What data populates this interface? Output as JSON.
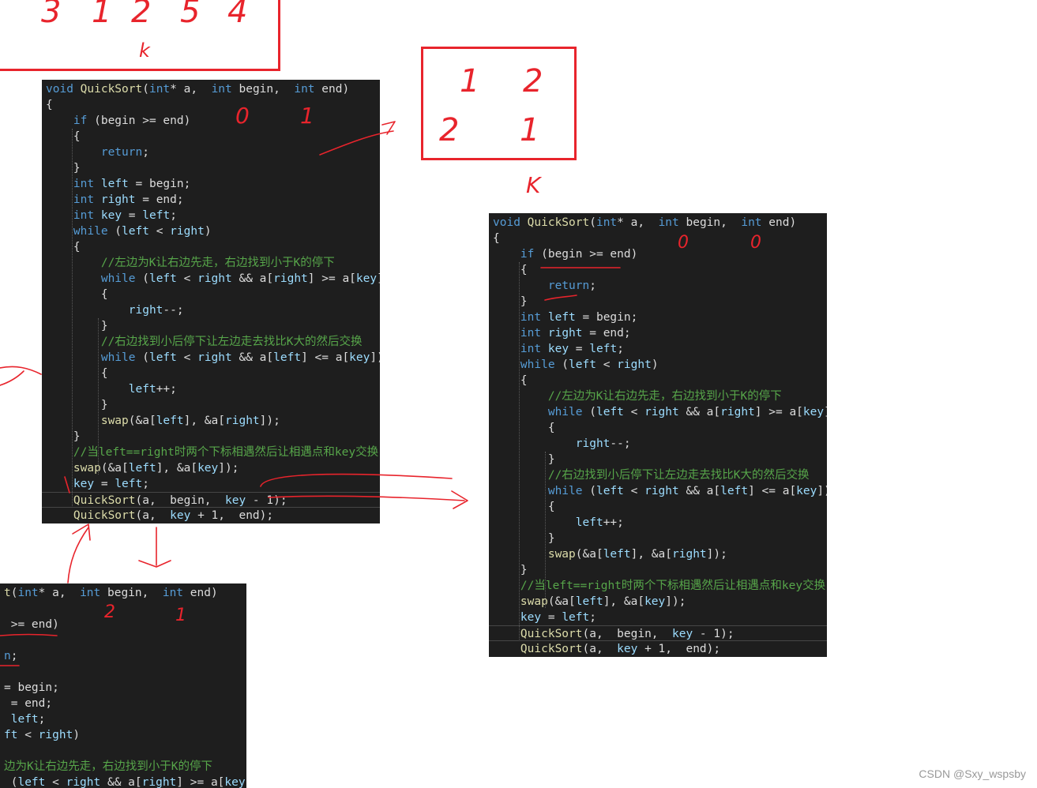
{
  "panels": [
    {
      "name": "code-panel-left",
      "lines": [
        [
          [
            "kw",
            "void "
          ],
          [
            "fn",
            "QuickSort"
          ],
          [
            "tx",
            "("
          ],
          [
            "kw",
            "int"
          ],
          [
            "tx",
            "* a,  "
          ],
          [
            "kw",
            "int"
          ],
          [
            "tx",
            " begin,  "
          ],
          [
            "kw",
            "int"
          ],
          [
            "tx",
            " end)"
          ]
        ],
        [
          [
            "tx",
            "{"
          ]
        ],
        [
          [
            "tx",
            "    "
          ],
          [
            "kw",
            "if"
          ],
          [
            "tx",
            " (begin >= end)"
          ]
        ],
        [
          [
            "tx",
            "    {"
          ]
        ],
        [
          [
            "tx",
            "        "
          ],
          [
            "kw",
            "return"
          ],
          [
            "tx",
            ";"
          ]
        ],
        [
          [
            "tx",
            "    }"
          ]
        ],
        [
          [
            "tx",
            "    "
          ],
          [
            "kw",
            "int"
          ],
          [
            "tx",
            " "
          ],
          [
            "id",
            "left"
          ],
          [
            "tx",
            " = begin;"
          ]
        ],
        [
          [
            "tx",
            "    "
          ],
          [
            "kw",
            "int"
          ],
          [
            "tx",
            " "
          ],
          [
            "id",
            "right"
          ],
          [
            "tx",
            " = end;"
          ]
        ],
        [
          [
            "tx",
            "    "
          ],
          [
            "kw",
            "int"
          ],
          [
            "tx",
            " "
          ],
          [
            "id",
            "key"
          ],
          [
            "tx",
            " = "
          ],
          [
            "id",
            "left"
          ],
          [
            "tx",
            ";"
          ]
        ],
        [
          [
            "tx",
            "    "
          ],
          [
            "kw",
            "while"
          ],
          [
            "tx",
            " ("
          ],
          [
            "id",
            "left"
          ],
          [
            "tx",
            " < "
          ],
          [
            "id",
            "right"
          ],
          [
            "tx",
            ")"
          ]
        ],
        [
          [
            "tx",
            "    {"
          ]
        ],
        [
          [
            "tx",
            "        "
          ],
          [
            "cm",
            "//左边为K让右边先走，右边找到小于K的停下"
          ]
        ],
        [
          [
            "tx",
            "        "
          ],
          [
            "kw",
            "while"
          ],
          [
            "tx",
            " ("
          ],
          [
            "id",
            "left"
          ],
          [
            "tx",
            " < "
          ],
          [
            "id",
            "right"
          ],
          [
            "tx",
            " && a["
          ],
          [
            "id",
            "right"
          ],
          [
            "tx",
            "] >= a["
          ],
          [
            "id",
            "key"
          ],
          [
            "tx",
            "])"
          ]
        ],
        [
          [
            "tx",
            "        {"
          ]
        ],
        [
          [
            "tx",
            "            "
          ],
          [
            "id",
            "right"
          ],
          [
            "tx",
            "--;"
          ]
        ],
        [
          [
            "tx",
            "        }"
          ]
        ],
        [
          [
            "tx",
            "        "
          ],
          [
            "cm",
            "//右边找到小后停下让左边走去找比K大的然后交换"
          ]
        ],
        [
          [
            "tx",
            "        "
          ],
          [
            "kw",
            "while"
          ],
          [
            "tx",
            " ("
          ],
          [
            "id",
            "left"
          ],
          [
            "tx",
            " < "
          ],
          [
            "id",
            "right"
          ],
          [
            "tx",
            " && a["
          ],
          [
            "id",
            "left"
          ],
          [
            "tx",
            "] <= a["
          ],
          [
            "id",
            "key"
          ],
          [
            "tx",
            "])"
          ]
        ],
        [
          [
            "tx",
            "        {"
          ]
        ],
        [
          [
            "tx",
            "            "
          ],
          [
            "id",
            "left"
          ],
          [
            "tx",
            "++;"
          ]
        ],
        [
          [
            "tx",
            "        }"
          ]
        ],
        [
          [
            "tx",
            "        "
          ],
          [
            "fn",
            "swap"
          ],
          [
            "tx",
            "(&a["
          ],
          [
            "id",
            "left"
          ],
          [
            "tx",
            "], &a["
          ],
          [
            "id",
            "right"
          ],
          [
            "tx",
            "]);"
          ]
        ],
        [
          [
            "tx",
            "    }"
          ]
        ],
        [
          [
            "tx",
            "    "
          ],
          [
            "cm",
            "//当left==right时两个下标相遇然后让相遇点和key交换"
          ]
        ],
        [
          [
            "tx",
            "    "
          ],
          [
            "fn",
            "swap"
          ],
          [
            "tx",
            "(&a["
          ],
          [
            "id",
            "left"
          ],
          [
            "tx",
            "], &a["
          ],
          [
            "id",
            "key"
          ],
          [
            "tx",
            "]);"
          ]
        ],
        [
          [
            "tx",
            "    "
          ],
          [
            "id",
            "key"
          ],
          [
            "tx",
            " = "
          ],
          [
            "id",
            "left"
          ],
          [
            "tx",
            ";"
          ]
        ],
        [
          [
            "tx",
            "    "
          ],
          [
            "fn",
            "QuickSort"
          ],
          [
            "tx",
            "(a,  begin,  "
          ],
          [
            "id",
            "key"
          ],
          [
            "tx",
            " - 1);"
          ]
        ],
        [
          [
            "tx",
            "    "
          ],
          [
            "fn",
            "QuickSort"
          ],
          [
            "tx",
            "(a,  "
          ],
          [
            "id",
            "key"
          ],
          [
            "tx",
            " + 1,  end);"
          ]
        ]
      ]
    },
    {
      "name": "code-panel-right",
      "lines": [
        [
          [
            "kw",
            "void "
          ],
          [
            "fn",
            "QuickSort"
          ],
          [
            "tx",
            "("
          ],
          [
            "kw",
            "int"
          ],
          [
            "tx",
            "* a,  "
          ],
          [
            "kw",
            "int"
          ],
          [
            "tx",
            " begin,  "
          ],
          [
            "kw",
            "int"
          ],
          [
            "tx",
            " end)"
          ]
        ],
        [
          [
            "tx",
            "{"
          ]
        ],
        [
          [
            "tx",
            "    "
          ],
          [
            "kw",
            "if"
          ],
          [
            "tx",
            " (begin >= end)"
          ]
        ],
        [
          [
            "tx",
            "    {"
          ]
        ],
        [
          [
            "tx",
            "        "
          ],
          [
            "kw",
            "return"
          ],
          [
            "tx",
            ";"
          ]
        ],
        [
          [
            "tx",
            "    }"
          ]
        ],
        [
          [
            "tx",
            "    "
          ],
          [
            "kw",
            "int"
          ],
          [
            "tx",
            " "
          ],
          [
            "id",
            "left"
          ],
          [
            "tx",
            " = begin;"
          ]
        ],
        [
          [
            "tx",
            "    "
          ],
          [
            "kw",
            "int"
          ],
          [
            "tx",
            " "
          ],
          [
            "id",
            "right"
          ],
          [
            "tx",
            " = end;"
          ]
        ],
        [
          [
            "tx",
            "    "
          ],
          [
            "kw",
            "int"
          ],
          [
            "tx",
            " "
          ],
          [
            "id",
            "key"
          ],
          [
            "tx",
            " = "
          ],
          [
            "id",
            "left"
          ],
          [
            "tx",
            ";"
          ]
        ],
        [
          [
            "tx",
            "    "
          ],
          [
            "kw",
            "while"
          ],
          [
            "tx",
            " ("
          ],
          [
            "id",
            "left"
          ],
          [
            "tx",
            " < "
          ],
          [
            "id",
            "right"
          ],
          [
            "tx",
            ")"
          ]
        ],
        [
          [
            "tx",
            "    {"
          ]
        ],
        [
          [
            "tx",
            "        "
          ],
          [
            "cm",
            "//左边为K让右边先走，右边找到小于K的停下"
          ]
        ],
        [
          [
            "tx",
            "        "
          ],
          [
            "kw",
            "while"
          ],
          [
            "tx",
            " ("
          ],
          [
            "id",
            "left"
          ],
          [
            "tx",
            " < "
          ],
          [
            "id",
            "right"
          ],
          [
            "tx",
            " && a["
          ],
          [
            "id",
            "right"
          ],
          [
            "tx",
            "] >= a["
          ],
          [
            "id",
            "key"
          ],
          [
            "tx",
            "])"
          ]
        ],
        [
          [
            "tx",
            "        {"
          ]
        ],
        [
          [
            "tx",
            "            "
          ],
          [
            "id",
            "right"
          ],
          [
            "tx",
            "--;"
          ]
        ],
        [
          [
            "tx",
            "        }"
          ]
        ],
        [
          [
            "tx",
            "        "
          ],
          [
            "cm",
            "//右边找到小后停下让左边走去找比K大的然后交换"
          ]
        ],
        [
          [
            "tx",
            "        "
          ],
          [
            "kw",
            "while"
          ],
          [
            "tx",
            " ("
          ],
          [
            "id",
            "left"
          ],
          [
            "tx",
            " < "
          ],
          [
            "id",
            "right"
          ],
          [
            "tx",
            " && a["
          ],
          [
            "id",
            "left"
          ],
          [
            "tx",
            "] <= a["
          ],
          [
            "id",
            "key"
          ],
          [
            "tx",
            "])"
          ]
        ],
        [
          [
            "tx",
            "        {"
          ]
        ],
        [
          [
            "tx",
            "            "
          ],
          [
            "id",
            "left"
          ],
          [
            "tx",
            "++;"
          ]
        ],
        [
          [
            "tx",
            "        }"
          ]
        ],
        [
          [
            "tx",
            "        "
          ],
          [
            "fn",
            "swap"
          ],
          [
            "tx",
            "(&a["
          ],
          [
            "id",
            "left"
          ],
          [
            "tx",
            "], &a["
          ],
          [
            "id",
            "right"
          ],
          [
            "tx",
            "]);"
          ]
        ],
        [
          [
            "tx",
            "    }"
          ]
        ],
        [
          [
            "tx",
            "    "
          ],
          [
            "cm",
            "//当left==right时两个下标相遇然后让相遇点和key交换"
          ]
        ],
        [
          [
            "tx",
            "    "
          ],
          [
            "fn",
            "swap"
          ],
          [
            "tx",
            "(&a["
          ],
          [
            "id",
            "left"
          ],
          [
            "tx",
            "], &a["
          ],
          [
            "id",
            "key"
          ],
          [
            "tx",
            "]);"
          ]
        ],
        [
          [
            "tx",
            "    "
          ],
          [
            "id",
            "key"
          ],
          [
            "tx",
            " = "
          ],
          [
            "id",
            "left"
          ],
          [
            "tx",
            ";"
          ]
        ],
        [
          [
            "tx",
            "    "
          ],
          [
            "fn",
            "QuickSort"
          ],
          [
            "tx",
            "(a,  begin,  "
          ],
          [
            "id",
            "key"
          ],
          [
            "tx",
            " - 1);"
          ]
        ],
        [
          [
            "tx",
            "    "
          ],
          [
            "fn",
            "QuickSort"
          ],
          [
            "tx",
            "(a,  "
          ],
          [
            "id",
            "key"
          ],
          [
            "tx",
            " + 1,  end);"
          ]
        ]
      ]
    },
    {
      "name": "code-panel-bottom",
      "lines": [
        [
          [
            "fn",
            "t"
          ],
          [
            "tx",
            "("
          ],
          [
            "kw",
            "int"
          ],
          [
            "tx",
            "* a,  "
          ],
          [
            "kw",
            "int"
          ],
          [
            "tx",
            " begin,  "
          ],
          [
            "kw",
            "int"
          ],
          [
            "tx",
            " end)"
          ]
        ],
        [
          [
            "tx",
            ""
          ]
        ],
        [
          [
            "tx",
            " >= end)"
          ]
        ],
        [
          [
            "tx",
            ""
          ]
        ],
        [
          [
            "kw",
            "n"
          ],
          [
            "tx",
            ";"
          ]
        ],
        [
          [
            "tx",
            ""
          ]
        ],
        [
          [
            "tx",
            "= begin;"
          ]
        ],
        [
          [
            "tx",
            " = end;"
          ]
        ],
        [
          [
            "tx",
            " "
          ],
          [
            "id",
            "left"
          ],
          [
            "tx",
            ";"
          ]
        ],
        [
          [
            "id",
            "ft"
          ],
          [
            "tx",
            " < "
          ],
          [
            "id",
            "right"
          ],
          [
            "tx",
            ")"
          ]
        ],
        [
          [
            "tx",
            ""
          ]
        ],
        [
          [
            "cm",
            "边为K让右边先走，右边找到小于K的停下"
          ]
        ],
        [
          [
            "tx",
            " ("
          ],
          [
            "id",
            "left"
          ],
          [
            "tx",
            " < "
          ],
          [
            "id",
            "right"
          ],
          [
            "tx",
            " && a["
          ],
          [
            "id",
            "right"
          ],
          [
            "tx",
            "] >= a["
          ],
          [
            "id",
            "key"
          ],
          [
            "tx",
            "])"
          ]
        ]
      ]
    }
  ],
  "annotations": {
    "box_top_left": [
      "3",
      "1",
      "2",
      "5",
      "4",
      "k"
    ],
    "box_middle": [
      "1",
      "2",
      "2",
      "1",
      "K"
    ],
    "notes_left_panel": [
      "0",
      "1"
    ],
    "notes_right_panel": [
      "0",
      "0"
    ],
    "notes_bottom_panel": [
      "2",
      "1"
    ],
    "ink_color": "#e8242c"
  },
  "watermark": "CSDN @Sxy_wspsby"
}
